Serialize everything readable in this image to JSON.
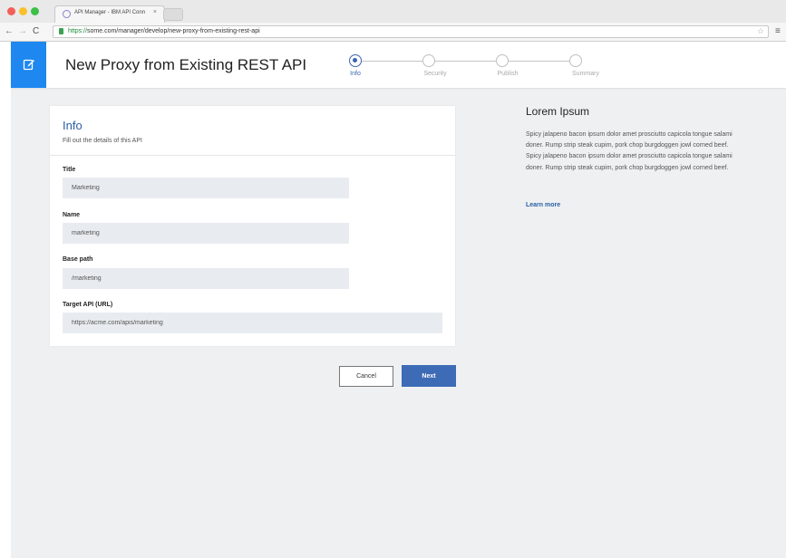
{
  "browser": {
    "tab_title": "API Manager - IBM API Conn",
    "tab_close": "×",
    "url_scheme": "https://",
    "url_rest": "some.com/manager/develop/new-proxy-from-existing-rest-api",
    "back_icon": "←",
    "forward_icon": "→",
    "reload_icon": "C",
    "star_icon": "☆",
    "menu_icon": "≡"
  },
  "header": {
    "title": "New Proxy from Existing REST API",
    "steps": [
      {
        "label": "Info",
        "active": true
      },
      {
        "label": "Security",
        "active": false
      },
      {
        "label": "Publish",
        "active": false
      },
      {
        "label": "Summary",
        "active": false
      }
    ]
  },
  "form": {
    "title": "Info",
    "subtitle": "Fill out the details of this API",
    "fields": [
      {
        "label": "Title",
        "value": "Marketing"
      },
      {
        "label": "Name",
        "value": "marketing"
      },
      {
        "label": "Base path",
        "value": "/marketing"
      },
      {
        "label": "Target API (URL)",
        "value": "https://acme.com/apis/marketing"
      }
    ],
    "cancel_label": "Cancel",
    "next_label": "Next"
  },
  "side": {
    "heading": "Lorem Ipsum",
    "body": "Spicy jalapeno bacon ipsum dolor amet prosciutto capicola tongue salami doner. Rump strip steak cupim, pork chop burgdoggen jowl corned beef. Spicy jalapeno bacon ipsum dolor amet prosciutto capicola tongue salami doner. Rump strip steak cupim, pork chop burgdoggen jowl corned beef.",
    "learn_more": "Learn more"
  },
  "colors": {
    "accent": "#1e87f0",
    "primary_button": "#3d6bb5",
    "link": "#2a5fa6"
  }
}
